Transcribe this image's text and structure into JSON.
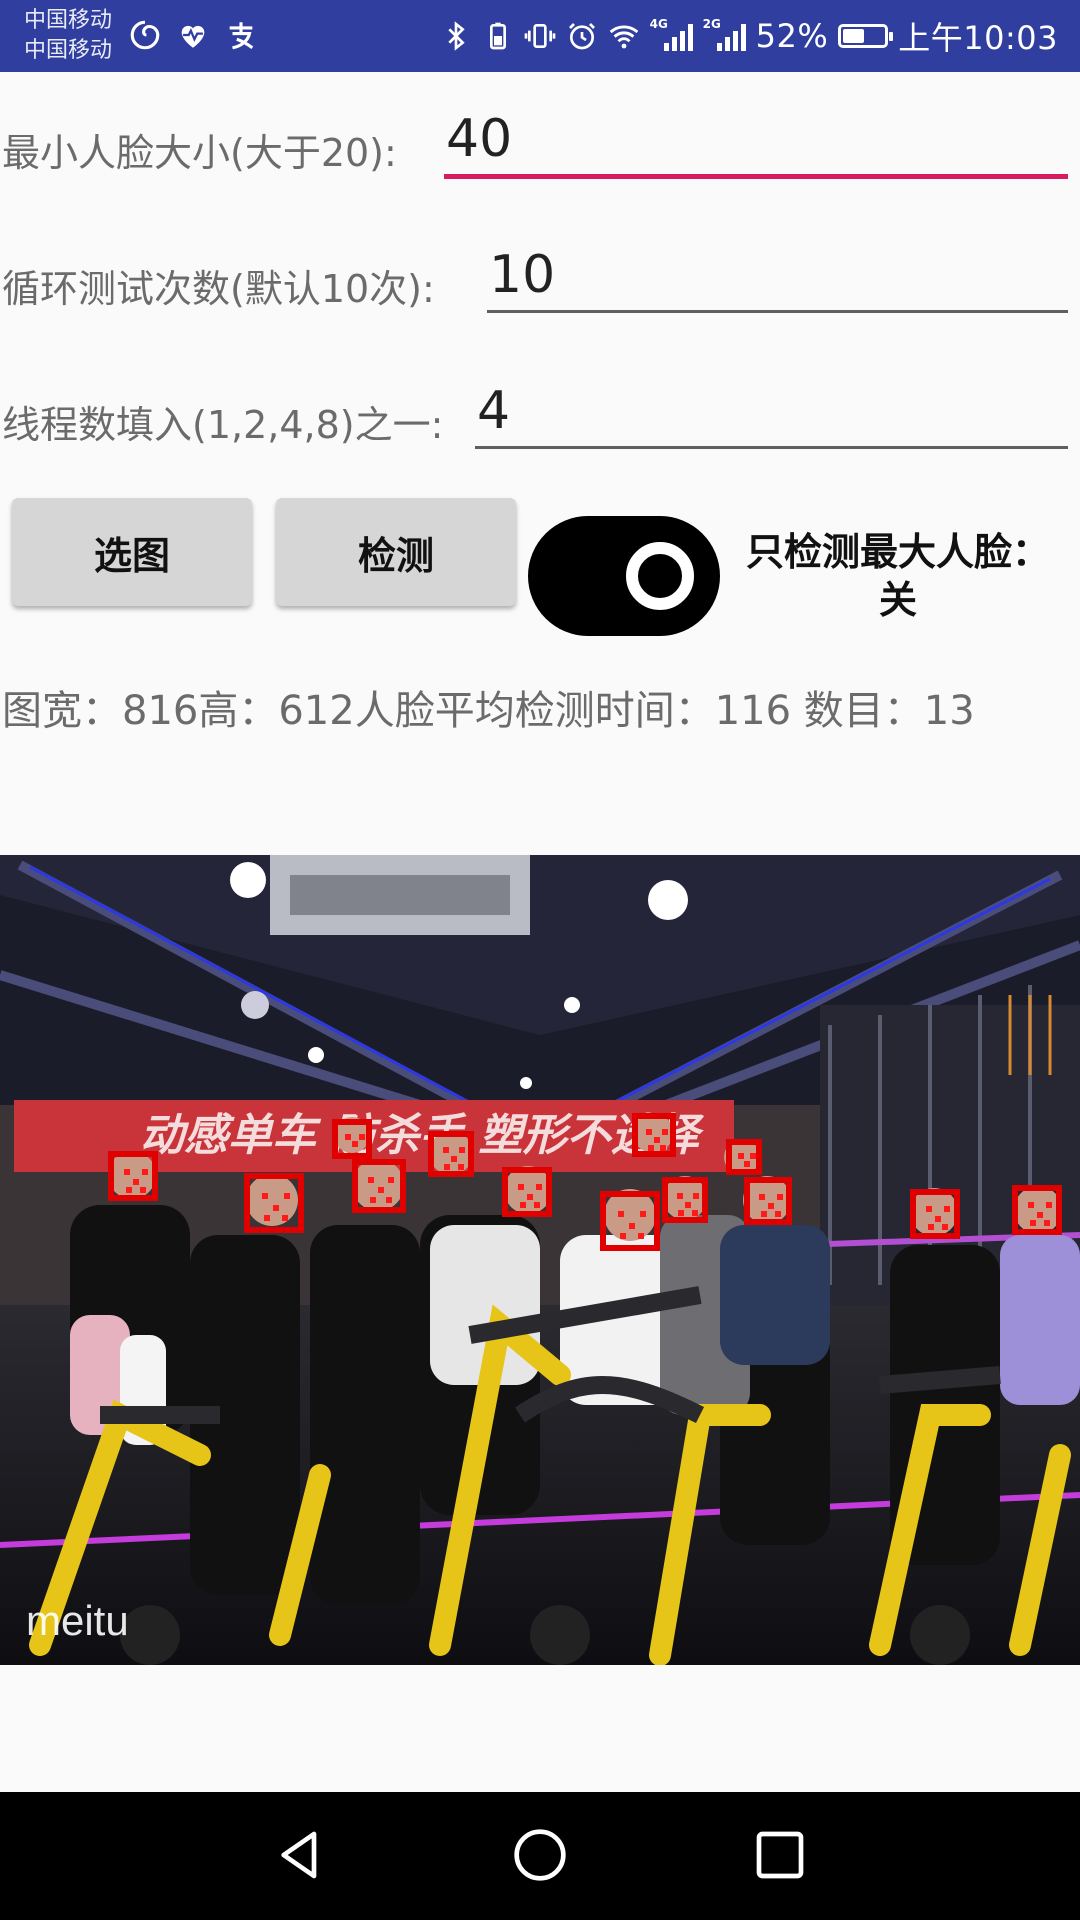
{
  "status_bar": {
    "carrier_1": "中国移动",
    "carrier_2": "中国移动",
    "network_1": "4G",
    "network_2": "2G",
    "battery": "52%",
    "battery_level": 0.52,
    "time": "上午10:03"
  },
  "form": {
    "min_face": {
      "label": "最小人脸大小(大于20):",
      "value": "40"
    },
    "loop_count": {
      "label": "循环测试次数(默认10次):",
      "value": "10"
    },
    "threads": {
      "label": "线程数填入(1,2,4,8)之一:",
      "value": "4"
    }
  },
  "buttons": {
    "select_image": "选图",
    "detect": "检测"
  },
  "toggle": {
    "label": "只检测最大人脸：关",
    "state": "off"
  },
  "result_text": "图宽：816高：612人脸平均检测时间：116 数目：13",
  "image": {
    "banner_text": "动感单车  防杀手  塑形不选择",
    "watermark": "meitu",
    "face_box_color": "#e00000",
    "faces_detected": 13
  },
  "colors": {
    "status_bar": "#303f9f",
    "accent": "#d81b60",
    "switch": "#000000"
  }
}
